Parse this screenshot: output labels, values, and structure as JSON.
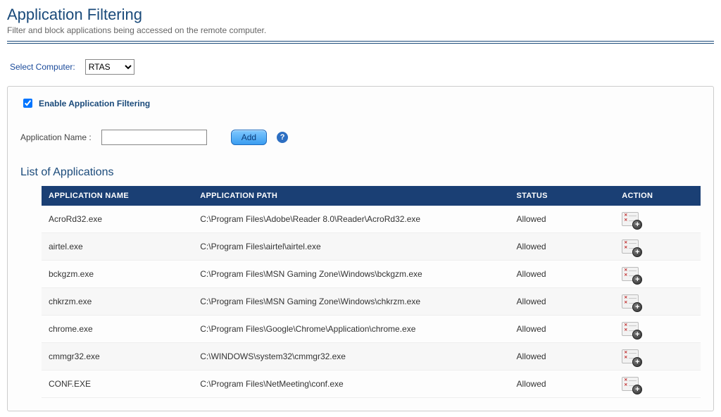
{
  "header": {
    "title": "Application Filtering",
    "subtitle": "Filter and block applications being accessed on the remote computer."
  },
  "selector": {
    "label": "Select Computer:",
    "value": "RTAS",
    "options": [
      "RTAS"
    ]
  },
  "enable": {
    "label": "Enable Application Filtering",
    "checked": true
  },
  "add": {
    "label": "Application Name :",
    "value": "",
    "placeholder": "",
    "button": "Add",
    "help": "?"
  },
  "list": {
    "heading": "List of Applications",
    "columns": {
      "name": "APPLICATION NAME",
      "path": "APPLICATION PATH",
      "status": "STATUS",
      "action": "ACTION"
    },
    "rows": [
      {
        "name": "AcroRd32.exe",
        "path": "C:\\Program Files\\Adobe\\Reader 8.0\\Reader\\AcroRd32.exe",
        "status": "Allowed"
      },
      {
        "name": "airtel.exe",
        "path": "C:\\Program Files\\airtel\\airtel.exe",
        "status": "Allowed"
      },
      {
        "name": "bckgzm.exe",
        "path": "C:\\Program Files\\MSN Gaming Zone\\Windows\\bckgzm.exe",
        "status": "Allowed"
      },
      {
        "name": "chkrzm.exe",
        "path": "C:\\Program Files\\MSN Gaming Zone\\Windows\\chkrzm.exe",
        "status": "Allowed"
      },
      {
        "name": "chrome.exe",
        "path": "C:\\Program Files\\Google\\Chrome\\Application\\chrome.exe",
        "status": "Allowed"
      },
      {
        "name": "cmmgr32.exe",
        "path": "C:\\WINDOWS\\system32\\cmmgr32.exe",
        "status": "Allowed"
      },
      {
        "name": "CONF.EXE",
        "path": "C:\\Program Files\\NetMeeting\\conf.exe",
        "status": "Allowed"
      }
    ]
  }
}
